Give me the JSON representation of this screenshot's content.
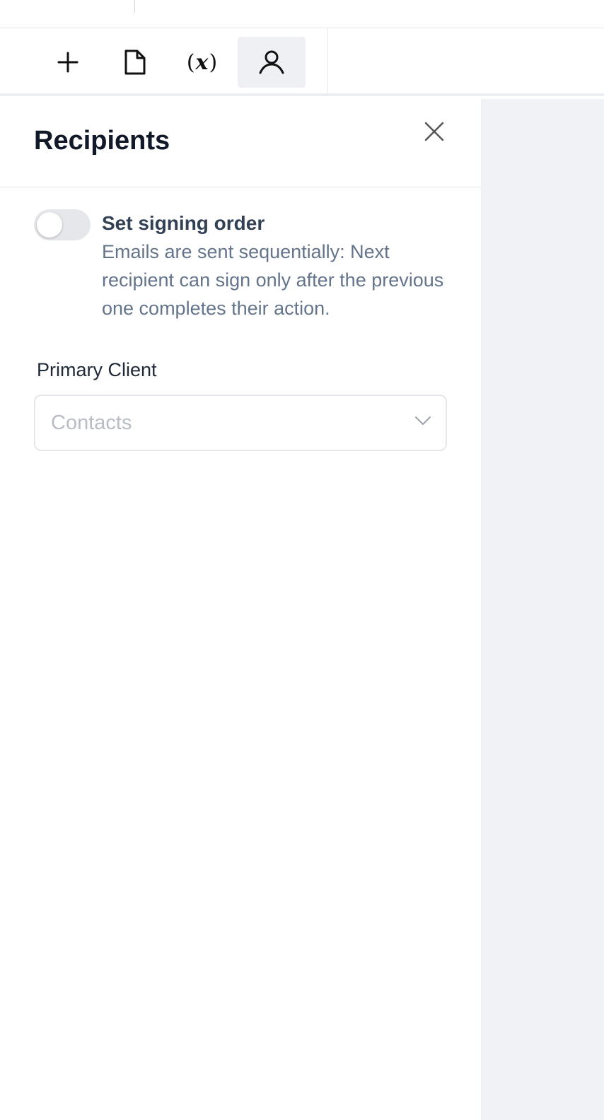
{
  "toolbar": {
    "buttons": [
      {
        "icon": "plus-icon",
        "active": false
      },
      {
        "icon": "document-icon",
        "active": false
      },
      {
        "icon": "variable-icon",
        "glyph_open": "(",
        "glyph_var": "x",
        "glyph_close": ")",
        "active": false
      },
      {
        "icon": "user-icon",
        "active": true
      }
    ]
  },
  "panel": {
    "title": "Recipients",
    "signing_order": {
      "label": "Set signing order",
      "description": "Emails are sent sequentially: Next recipient can sign only after the previous one completes their action.",
      "enabled": false
    },
    "primary_client": {
      "label": "Primary Client",
      "placeholder": "Contacts"
    }
  },
  "colors": {
    "active_tool_bg": "#eef0f4",
    "title": "#111827",
    "muted_text": "#64748b",
    "side_background": "#f1f2f6"
  }
}
